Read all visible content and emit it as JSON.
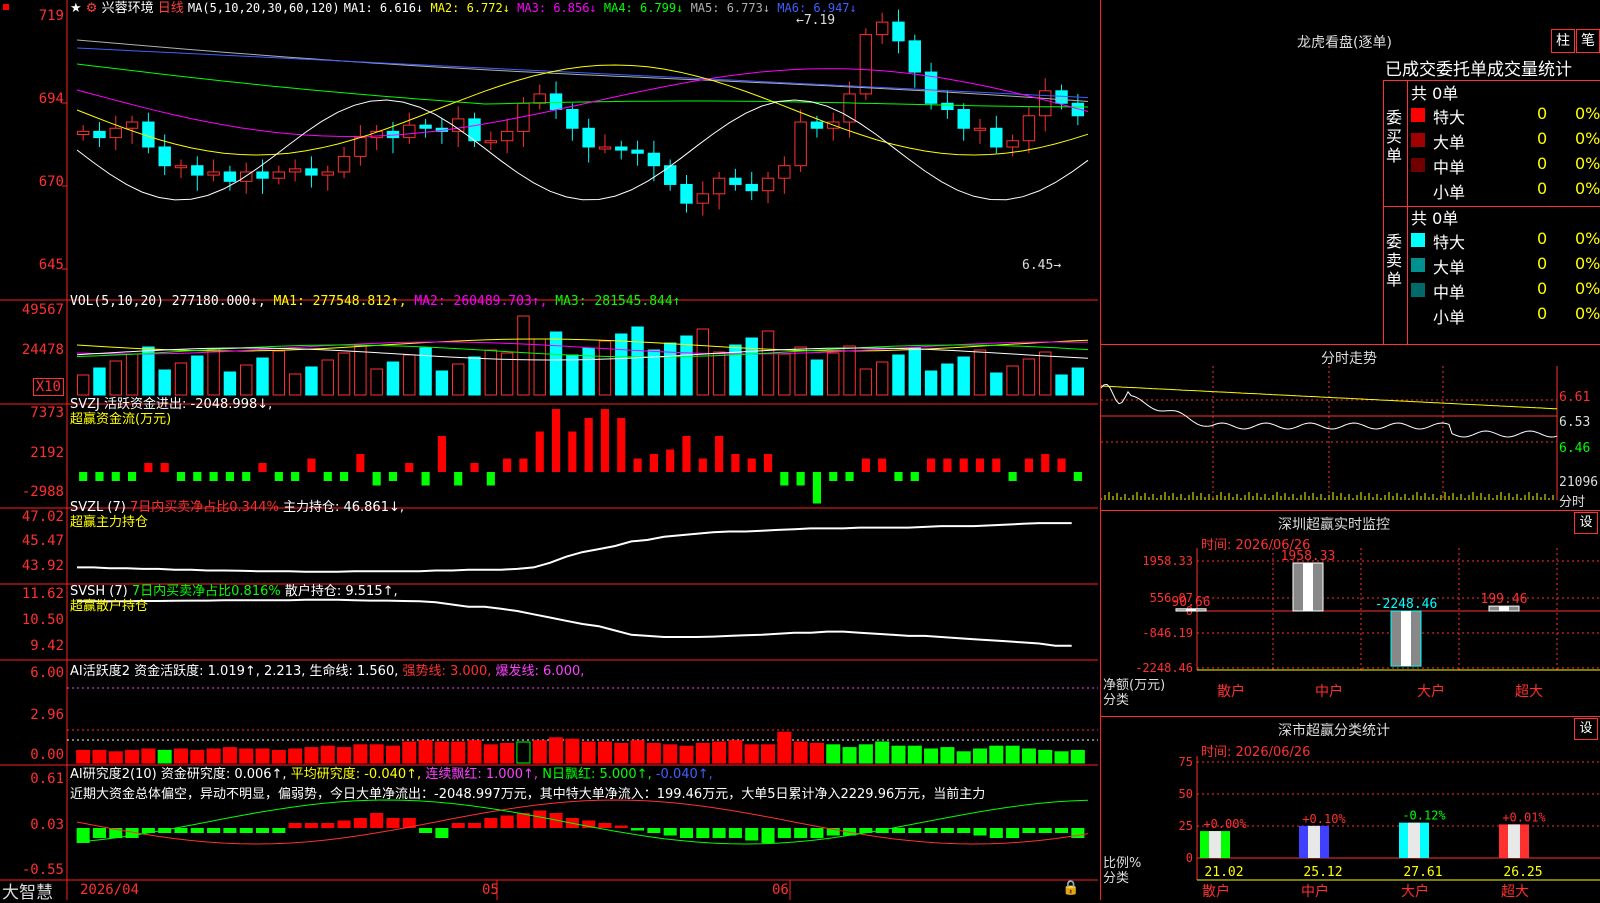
{
  "stock": {
    "name": "兴蓉环境",
    "period": "日线"
  },
  "main_ind": {
    "label": "MA(5,10,20,30,60,120)",
    "ma": [
      {
        "k": "MA1:",
        "v": "6.616↓",
        "color": "#ffffff"
      },
      {
        "k": "MA2:",
        "v": "6.772↓",
        "color": "#ffff00"
      },
      {
        "k": "MA3:",
        "v": "6.856↓",
        "color": "#ff00ff"
      },
      {
        "k": "MA4:",
        "v": "6.799↓",
        "color": "#00ff00"
      },
      {
        "k": "MA5:",
        "v": "6.773↓",
        "color": "#b0b0b0"
      },
      {
        "k": "MA6:",
        "v": "6.947↓",
        "color": "#4060ff"
      }
    ],
    "yaxis": [
      "719",
      "694",
      "670",
      "645"
    ],
    "high_label": "7.19",
    "low_label": "6.45"
  },
  "vol_panel": {
    "label": "VOL(5,10,20)",
    "items": [
      {
        "t": "277180.000↓,",
        "color": "#ffffff"
      },
      {
        "t": "MA1: 277548.812↑,",
        "color": "#ffff00"
      },
      {
        "t": "MA2: 260489.703↑,",
        "color": "#ff00ff"
      },
      {
        "t": "MA3: 281545.844↑",
        "color": "#00ff00"
      }
    ],
    "yaxis": [
      "49567",
      "24478"
    ],
    "unit": "X10"
  },
  "svzj": {
    "line1": "SVZJ  活跃资金进出: -2048.998↓,",
    "line2": "超赢资金流(万元)",
    "yaxis": [
      "7373",
      "2192",
      "-2988"
    ],
    "bars": [
      -2,
      -2,
      -2,
      -2,
      2,
      2,
      -2,
      -2,
      -2,
      -2,
      -2,
      2,
      -2,
      -2,
      3,
      -2,
      -2,
      4,
      -3,
      -2,
      2,
      -3,
      8,
      -3,
      2,
      -3,
      3,
      3,
      9,
      14,
      9,
      12,
      14,
      12,
      3,
      4,
      5,
      8,
      3,
      8,
      4,
      3,
      4,
      -3,
      -3,
      -7,
      -2,
      -2,
      3,
      3,
      -2,
      -2,
      3,
      3,
      3,
      3,
      3,
      -2,
      3,
      4,
      3,
      -2,
      -6
    ]
  },
  "svzl": {
    "line1a": "SVZL (7)",
    "line1b": "7日内买卖净占比0.344%",
    "line1c": "主力持仓: 46.861↓,",
    "line2": "超赢主力持仓",
    "yaxis": [
      "47.02",
      "45.47",
      "43.92"
    ],
    "values": [
      44.0,
      44.0,
      43.95,
      43.95,
      43.9,
      43.9,
      43.85,
      43.85,
      43.8,
      43.8,
      43.78,
      43.75,
      43.75,
      43.75,
      43.72,
      43.72,
      43.72,
      43.75,
      43.75,
      43.75,
      43.75,
      43.75,
      43.8,
      43.8,
      43.85,
      43.85,
      43.85,
      43.9,
      44.0,
      44.3,
      44.7,
      45.0,
      45.2,
      45.4,
      45.7,
      45.8,
      46.0,
      46.1,
      46.2,
      46.3,
      46.35,
      46.35,
      46.4,
      46.45,
      46.5,
      46.55,
      46.55,
      46.55,
      46.6,
      46.6,
      46.6,
      46.6,
      46.65,
      46.7,
      46.7,
      46.7,
      46.75,
      46.8,
      46.85,
      46.9,
      46.9,
      46.9,
      46.86
    ]
  },
  "svsh": {
    "line1a": "SVSH (7)",
    "line1b": "7日内买卖净占比0.816%",
    "line1c": "散户持仓: 9.515↑,",
    "line2": "超赢散户持仓",
    "yaxis": [
      "11.62",
      "10.50",
      "9.42"
    ],
    "values": [
      11.55,
      11.55,
      11.55,
      11.55,
      11.56,
      11.56,
      11.57,
      11.58,
      11.58,
      11.6,
      11.6,
      11.6,
      11.6,
      11.6,
      11.62,
      11.62,
      11.62,
      11.6,
      11.58,
      11.58,
      11.56,
      11.55,
      11.5,
      11.4,
      11.3,
      11.3,
      11.2,
      11.1,
      10.95,
      10.8,
      10.65,
      10.5,
      10.4,
      10.2,
      10.0,
      9.95,
      9.9,
      9.9,
      9.9,
      9.92,
      9.95,
      9.98,
      10.0,
      10.05,
      10.1,
      10.1,
      10.15,
      10.15,
      10.1,
      10.05,
      10.0,
      9.95,
      9.95,
      9.9,
      9.85,
      9.8,
      9.75,
      9.7,
      9.65,
      9.6,
      9.5,
      9.5,
      9.515
    ]
  },
  "ai_act": {
    "line": "AI活跃度2 资金活跃度: 1.019↑, 2.213, 生命线: 1.560,",
    "line_b": "强势线: 3.000,",
    "line_c": "爆发线: 6.000,",
    "yaxis": [
      "6.00",
      "2.96",
      "0.00"
    ],
    "bars": [
      0.9,
      0.9,
      0.8,
      0.9,
      1.0,
      0.9,
      1.0,
      0.9,
      1.0,
      1.1,
      1.0,
      1.0,
      0.9,
      1.0,
      1.1,
      1.2,
      1.1,
      1.3,
      1.3,
      1.2,
      1.5,
      1.6,
      1.5,
      1.5,
      1.6,
      1.3,
      1.4,
      1.5,
      1.6,
      1.8,
      1.7,
      1.5,
      1.5,
      1.4,
      1.6,
      1.4,
      1.3,
      1.2,
      1.4,
      1.5,
      1.6,
      1.3,
      1.3,
      2.2,
      1.5,
      1.4,
      1.3,
      1.1,
      1.3,
      1.5,
      1.2,
      1.2,
      1.0,
      1.1,
      0.8,
      1.0,
      1.2,
      1.2,
      1.0,
      0.9,
      0.8,
      0.9,
      0.9
    ],
    "colors": "rrrrrgrrrrrrrrrrrrrrrrrrrrrorrrrrrrrrrrrrrrrrrgggggggggggggggggggggggg"
  },
  "ai_res": {
    "line_a": "AI研究度2(10) 资金研究度: 0.006↑,",
    "line_b": "平均研究度: -0.040↑,",
    "line_c": "连续飘红: 1.000↑,",
    "line_d": "N日飘红: 5.000↑,",
    "line_e": "-0.040↑,",
    "text": "近期大资金总体偏空，异动不明显，偏弱势，今日大单净流出：-2048.997万元，其中特大单净流入：199.46万元，大单5日累计净入2229.96万元，当前主力",
    "yaxis": [
      "0.61",
      "0.03",
      "-0.55"
    ],
    "bars": [
      -0.3,
      -0.2,
      -0.2,
      -0.2,
      -0.1,
      -0.1,
      -0.1,
      -0.1,
      -0.1,
      -0.1,
      -0.1,
      -0.1,
      -0.1,
      0.1,
      0.1,
      0.1,
      0.15,
      0.2,
      0.3,
      0.2,
      0.2,
      -0.1,
      -0.2,
      0.1,
      0.1,
      0.2,
      0.25,
      0.3,
      0.35,
      0.3,
      0.2,
      0.15,
      0.1,
      0.05,
      -0.05,
      -0.1,
      -0.15,
      -0.2,
      -0.2,
      -0.2,
      -0.2,
      -0.25,
      -0.3,
      -0.2,
      -0.2,
      -0.2,
      -0.15,
      -0.15,
      -0.1,
      -0.1,
      -0.1,
      -0.1,
      -0.1,
      -0.1,
      -0.1,
      -0.15,
      -0.2,
      -0.2,
      -0.1,
      -0.1,
      -0.1,
      -0.2,
      -0.1
    ]
  },
  "xaxis": {
    "left": "2026/04",
    "m1": "05",
    "m2": "06"
  },
  "brand": "大智慧",
  "longhu": {
    "title": "龙虎看盘(逐单)",
    "btn1": "柱",
    "btn2": "笔",
    "header": "已成交委托单成交量统计",
    "buy_group": "委买单",
    "sell_group": "委卖单",
    "total_buy": "共 0单",
    "total_sell": "共 0单",
    "rows": [
      {
        "label": "特大",
        "val": "0",
        "pct": "0%"
      },
      {
        "label": "大单",
        "val": "0",
        "pct": "0%"
      },
      {
        "label": "中单",
        "val": "0",
        "pct": "0%"
      },
      {
        "label": "小单",
        "val": "0",
        "pct": "0%"
      }
    ],
    "colors_buy": [
      "#ff0000",
      "#a00000",
      "#700000",
      "#000000"
    ],
    "colors_sell": [
      "#00ffff",
      "#009090",
      "#006a6a",
      "#000000"
    ]
  },
  "intraday": {
    "title": "分时走势",
    "yaxis": [
      "6.61",
      "6.53",
      "6.46"
    ],
    "vol_label": "21096",
    "vol_unit": "分时"
  },
  "sz_monitor": {
    "title": "深圳超赢实时监控",
    "btn": "设",
    "time": "时间: 2026/06/26",
    "yaxis": [
      "1958.33",
      "556.07",
      "0",
      "-846.19",
      "-2248.46"
    ],
    "unit_a": "净额(万元)",
    "unit_b": "分类",
    "cats": [
      "散户",
      "中户",
      "大户",
      "超大"
    ],
    "values": [
      90.66,
      1958.33,
      -2248.46,
      199.46
    ],
    "labels": [
      "90.66",
      "1958.33",
      "-2248.46",
      "199.46"
    ]
  },
  "sz_class": {
    "title": "深市超赢分类统计",
    "btn": "设",
    "time": "时间: 2026/06/26",
    "yaxis": [
      "75",
      "50",
      "25",
      "0"
    ],
    "unit_a": "比例%",
    "unit_b": "分类",
    "cats": [
      "散户",
      "中户",
      "大户",
      "超大"
    ],
    "pct": [
      21.02,
      25.12,
      27.61,
      26.25
    ],
    "changes": [
      "+0.00%",
      "+0.10%",
      "-0.12%",
      "+0.01%"
    ],
    "colors": [
      "#00ff00",
      "#4040ff",
      "#00ffff",
      "#ff3030"
    ]
  }
}
